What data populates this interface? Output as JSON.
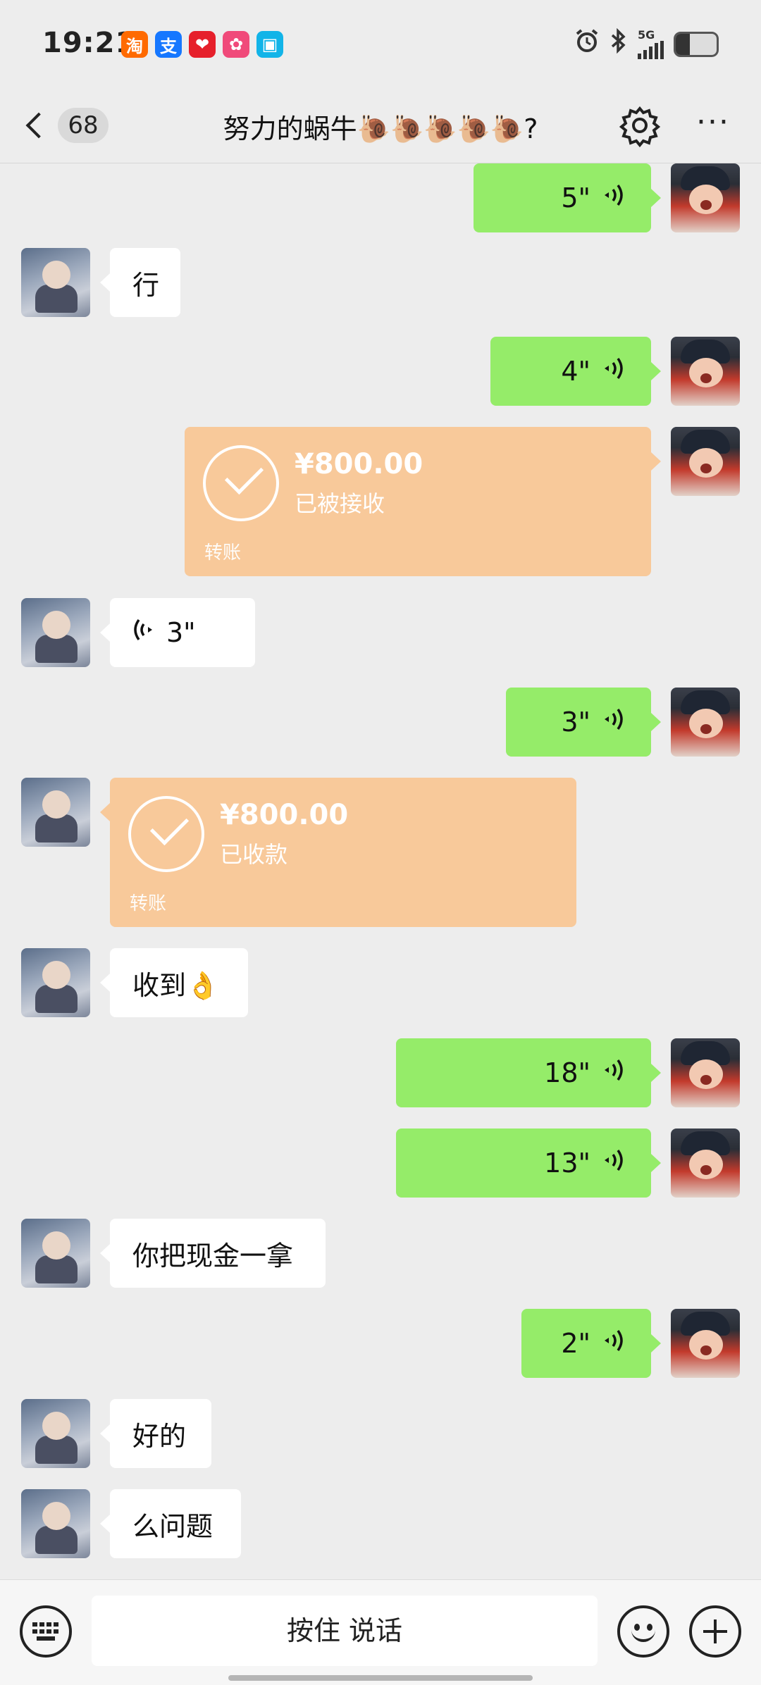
{
  "status_bar": {
    "time": "19:21",
    "network": "5G",
    "apps": [
      {
        "name": "taobao-icon",
        "glyph": "淘",
        "color": "#ff6a00"
      },
      {
        "name": "alipay-icon",
        "glyph": "支",
        "color": "#1677ff"
      },
      {
        "name": "app-red-icon",
        "glyph": "❤",
        "color": "#e6202b"
      },
      {
        "name": "app-game-icon",
        "glyph": "✿",
        "color": "#f04a7a"
      },
      {
        "name": "app-blue-icon",
        "glyph": "▣",
        "color": "#12b4e8"
      }
    ],
    "battery_level": 0.35
  },
  "nav": {
    "back_count": "68",
    "title": "努力的蜗牛🐌🐌🐌🐌🐌?"
  },
  "messages": [
    {
      "side": "right",
      "type": "voice",
      "text": "5\""
    },
    {
      "side": "left",
      "type": "text",
      "text": "行"
    },
    {
      "side": "right",
      "type": "voice",
      "text": "4\""
    },
    {
      "side": "right",
      "type": "transfer",
      "amount": "¥800.00",
      "status": "已被接收",
      "label": "转账"
    },
    {
      "side": "left",
      "type": "voice",
      "text": "3\""
    },
    {
      "side": "right",
      "type": "voice",
      "text": "3\""
    },
    {
      "side": "left",
      "type": "transfer",
      "amount": "¥800.00",
      "status": "已收款",
      "label": "转账"
    },
    {
      "side": "left",
      "type": "text",
      "text": "收到👌"
    },
    {
      "side": "right",
      "type": "voice",
      "text": "18\""
    },
    {
      "side": "right",
      "type": "voice",
      "text": "13\""
    },
    {
      "side": "left",
      "type": "text",
      "text": "你把现金一拿"
    },
    {
      "side": "right",
      "type": "voice",
      "text": "2\""
    },
    {
      "side": "left",
      "type": "text",
      "text": "好的"
    },
    {
      "side": "left",
      "type": "text",
      "text": "么问题"
    }
  ],
  "input_bar": {
    "talk_label": "按住 说话"
  },
  "colors": {
    "background": "#ededed",
    "sent_bubble": "#95ec69",
    "received_bubble": "#ffffff",
    "transfer": "#f8c99a"
  }
}
